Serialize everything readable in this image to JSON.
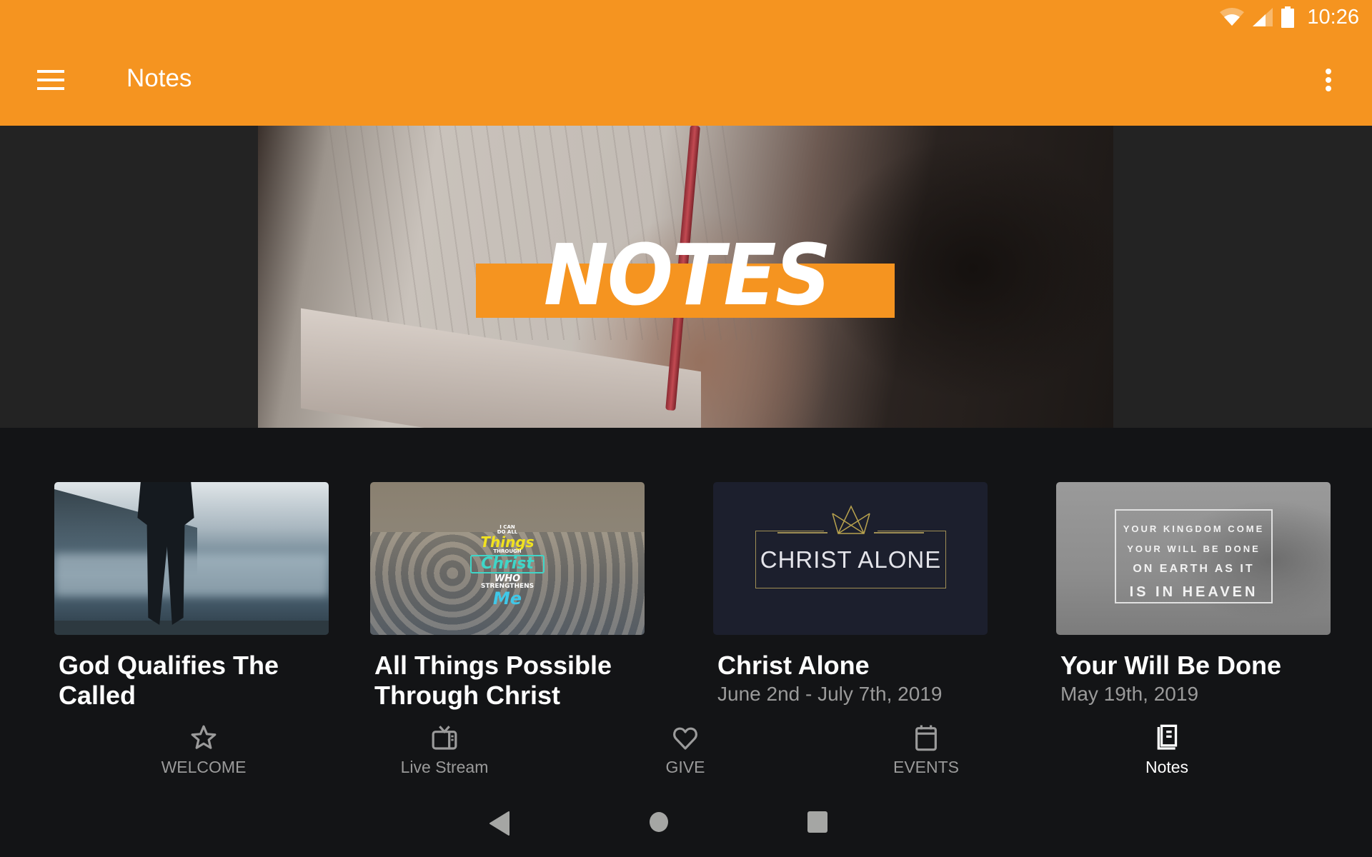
{
  "status_bar": {
    "time": "10:26",
    "icons": [
      "wifi-icon",
      "cell-signal-icon",
      "battery-icon"
    ]
  },
  "app_bar": {
    "title": "Notes",
    "menu_icon": "hamburger-menu-icon",
    "overflow_icon": "more-vert-icon",
    "color": "#f59420"
  },
  "hero": {
    "banner_text": "NOTES",
    "banner_color": "#f59420"
  },
  "cards": [
    {
      "title": "God Qualifies The Called",
      "date": "",
      "thumbnail": "man-standing-by-foggy-lake"
    },
    {
      "title": "All Things Possible Through Christ",
      "date": "",
      "thumbnail": "verse-graphic-clouds",
      "thumbnail_text": {
        "line1": "I CAN",
        "line2": "DO ALL",
        "things": "Things",
        "through": "THROUGH",
        "christ": "Christ",
        "who": "WHO",
        "strengthens": "STRENGTHENS",
        "me": "Me"
      }
    },
    {
      "title": "Christ Alone",
      "date": "June 2nd - July 7th, 2019",
      "thumbnail": "christ-alone-crown-graphic",
      "thumbnail_text": "CHRIST ALONE"
    },
    {
      "title": "Your Will Be Done",
      "date": "May 19th, 2019",
      "thumbnail": "grey-sky-verse-graphic",
      "thumbnail_text": {
        "line1": "YOUR KINGDOM COME",
        "line2": "YOUR WILL BE DONE",
        "line3": "ON EARTH AS IT",
        "line4": "IS IN HEAVEN"
      }
    }
  ],
  "bottom_nav": {
    "items": [
      {
        "label": "WELCOME",
        "icon": "star-icon",
        "active": false
      },
      {
        "label": "Live Stream",
        "icon": "tv-icon",
        "active": false
      },
      {
        "label": "GIVE",
        "icon": "heart-icon",
        "active": false
      },
      {
        "label": "EVENTS",
        "icon": "calendar-icon",
        "active": false
      },
      {
        "label": "Notes",
        "icon": "notebook-icon",
        "active": true
      }
    ],
    "inactive_color": "#9b9b9b",
    "active_color": "#ffffff"
  },
  "system_nav": {
    "buttons": [
      "back-icon",
      "home-icon",
      "recents-icon"
    ]
  }
}
